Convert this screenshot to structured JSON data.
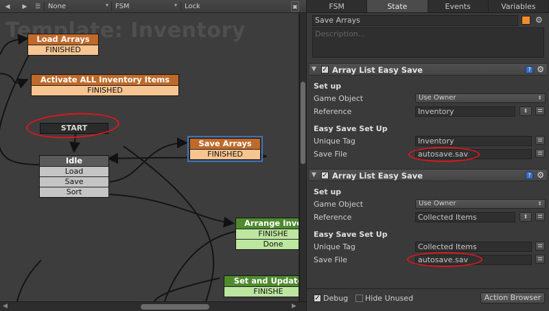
{
  "toolbar": {
    "fsm_owner": "None",
    "fsm_name": "FSM",
    "lock_label": "Lock"
  },
  "graph": {
    "template_title": "Template: Inventory",
    "start_label": "START",
    "nodes": {
      "load_arrays": {
        "title": "Load Arrays",
        "events": [
          "FINISHED"
        ]
      },
      "activate_all": {
        "title": "Activate ALL Inventory Items",
        "events": [
          "FINISHED"
        ]
      },
      "idle": {
        "title": "Idle",
        "events": [
          "Load",
          "Save",
          "Sort"
        ]
      },
      "save_arrays": {
        "title": "Save Arrays",
        "events": [
          "FINISHED"
        ]
      },
      "arrange": {
        "title": "Arrange Inve",
        "events": [
          "FINISHE",
          "Done"
        ]
      },
      "set_update": {
        "title": "Set and Update",
        "events": [
          "FINISHE"
        ]
      }
    }
  },
  "inspector": {
    "tabs": [
      "FSM",
      "State",
      "Events",
      "Variables"
    ],
    "active_tab": "State",
    "state_name": "Save Arrays",
    "state_color": "#f08a2c",
    "description_placeholder": "Description...",
    "actions": [
      {
        "title": "Array List Easy Save",
        "setup_header": "Set up",
        "game_object_label": "Game Object",
        "game_object_value": "Use Owner",
        "reference_label": "Reference",
        "reference_value": "Inventory",
        "easy_save_header": "Easy Save Set Up",
        "unique_tag_label": "Unique Tag",
        "unique_tag_value": "Inventory",
        "save_file_label": "Save File",
        "save_file_value": "autosave.sav"
      },
      {
        "title": "Array List Easy Save",
        "setup_header": "Set up",
        "game_object_label": "Game Object",
        "game_object_value": "Use Owner",
        "reference_label": "Reference",
        "reference_value": "Collected Items",
        "easy_save_header": "Easy Save Set Up",
        "unique_tag_label": "Unique Tag",
        "unique_tag_value": "Collected Items",
        "save_file_label": "Save File",
        "save_file_value": "autosave.sav"
      }
    ],
    "footer": {
      "debug_label": "Debug",
      "hide_unused_label": "Hide Unused",
      "action_browser_label": "Action Browser"
    }
  }
}
